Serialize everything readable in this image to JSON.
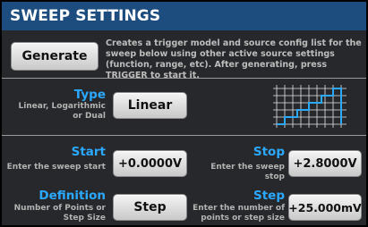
{
  "header": {
    "title": "SWEEP SETTINGS"
  },
  "generate": {
    "label": "Generate",
    "description": "Creates a trigger model and source config list for the sweep below using other active source settings (function, range, etc). After generating, press TRIGGER to start it."
  },
  "type": {
    "title": "Type",
    "subtitle_line1": "Linear, Logarithmic",
    "subtitle_line2": "or Dual",
    "value": "Linear",
    "preview_icon": "staircase-sweep-graph-icon"
  },
  "start": {
    "title": "Start",
    "subtitle": "Enter the sweep start",
    "value": "+0.0000V"
  },
  "stop": {
    "title": "Stop",
    "subtitle": "Enter the sweep stop",
    "value": "+2.8000V"
  },
  "definition": {
    "title": "Definition",
    "subtitle_line1": "Number of Points or",
    "subtitle_line2": "Step Size",
    "value": "Step"
  },
  "step": {
    "title": "Step",
    "subtitle_line1": "Enter the number of",
    "subtitle_line2": "points or step size",
    "value": "+25.000mV"
  },
  "colors": {
    "header_bg": "#1c4d7e",
    "panel_bg": "#27282b",
    "accent_blue": "#2aa9ff",
    "staircase": "#2aa9ff"
  }
}
